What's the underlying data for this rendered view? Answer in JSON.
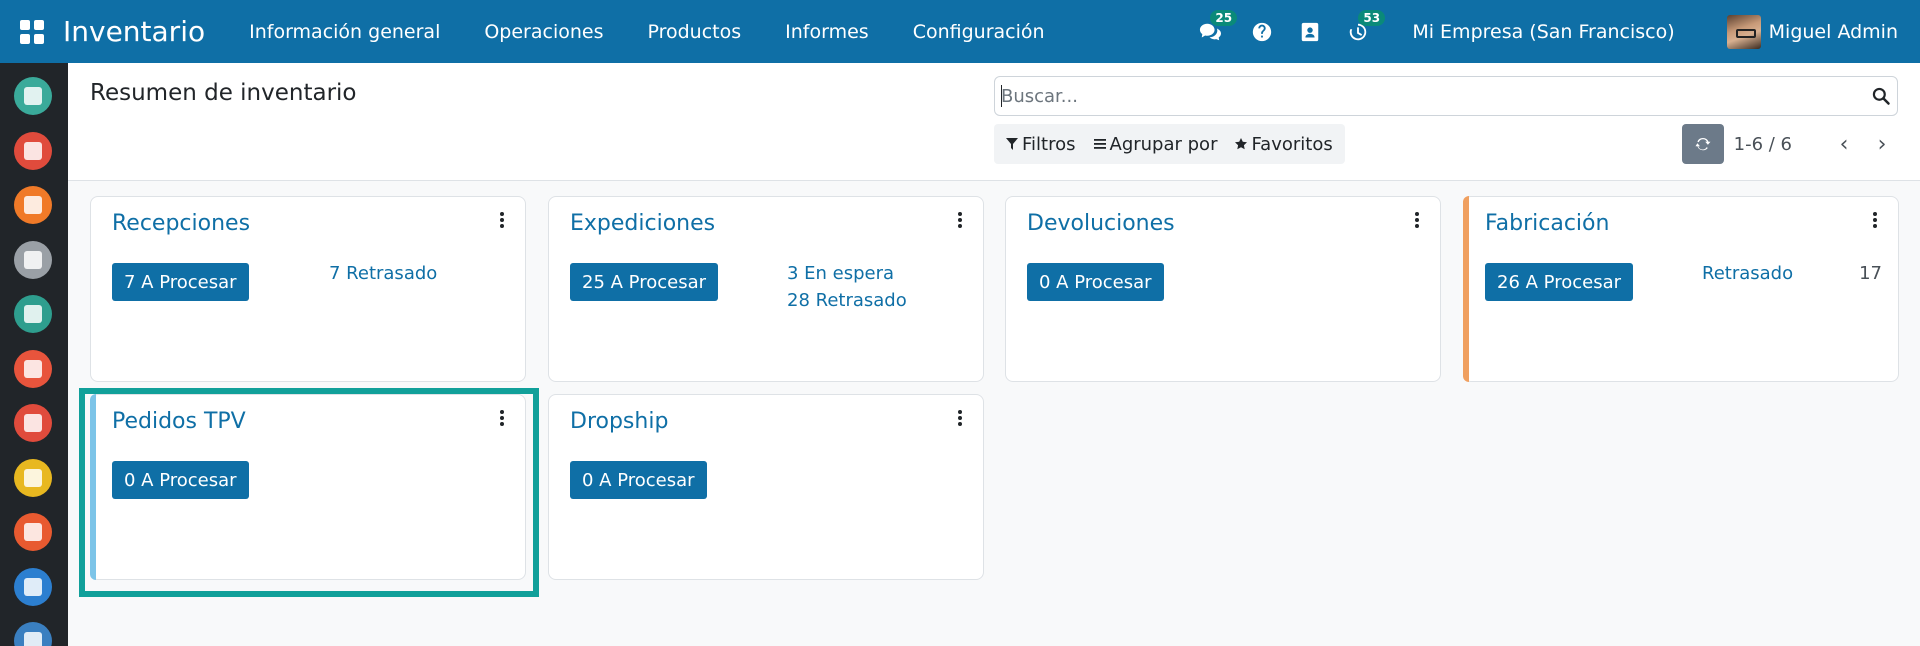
{
  "navbar": {
    "app_name": "Inventario",
    "menu": [
      "Información general",
      "Operaciones",
      "Productos",
      "Informes",
      "Configuración"
    ],
    "messages_badge": "25",
    "activities_badge": "53",
    "company": "Mi Empresa (San Francisco)",
    "user_name": "Miguel Admin"
  },
  "sidebar": {
    "icons": [
      {
        "name": "discuss-app-icon",
        "color": "#3aaa9a"
      },
      {
        "name": "calendar-app-icon",
        "color": "#e04b3c"
      },
      {
        "name": "contacts-app-icon",
        "color": "#f07a28"
      },
      {
        "name": "crm-app-icon",
        "color": "#9aa0a6"
      },
      {
        "name": "employees-app-icon",
        "color": "#2e9e8e"
      },
      {
        "name": "sales-app-icon",
        "color": "#e8543c"
      },
      {
        "name": "dashboards-app-icon",
        "color": "#e04b3c"
      },
      {
        "name": "website-app-icon",
        "color": "#e8b820"
      },
      {
        "name": "expenses-app-icon",
        "color": "#e85a30"
      },
      {
        "name": "pos-app-icon",
        "color": "#2c7fd0"
      },
      {
        "name": "inventory-app-icon",
        "color": "#3a7fc0"
      }
    ]
  },
  "control_panel": {
    "title": "Resumen de inventario",
    "search_placeholder": "Buscar...",
    "filters_label": "Filtros",
    "group_by_label": "Agrupar por",
    "favorites_label": "Favoritos",
    "pager": "1-6 / 6"
  },
  "cards": [
    {
      "title": "Recepciones",
      "button": "7 A Procesar",
      "links": [
        "7 Retrasado"
      ],
      "number": "",
      "accent": ""
    },
    {
      "title": "Expediciones",
      "button": "25 A Procesar",
      "links": [
        "3 En espera",
        "28 Retrasado"
      ],
      "number": "",
      "accent": ""
    },
    {
      "title": "Devoluciones",
      "button": "0 A Procesar",
      "links": [],
      "number": "",
      "accent": ""
    },
    {
      "title": "Fabricación",
      "button": "26 A Procesar",
      "links": [
        "Retrasado"
      ],
      "number": "17",
      "accent": "#f0a060"
    },
    {
      "title": "Pedidos TPV",
      "button": "0 A Procesar",
      "links": [],
      "number": "",
      "accent": "#7cc4e8"
    },
    {
      "title": "Dropship",
      "button": "0 A Procesar",
      "links": [],
      "number": "",
      "accent": ""
    }
  ],
  "colors": {
    "primary": "#0f6fa6",
    "badge": "#0a8a79",
    "selection_outline": "#11a09a"
  }
}
